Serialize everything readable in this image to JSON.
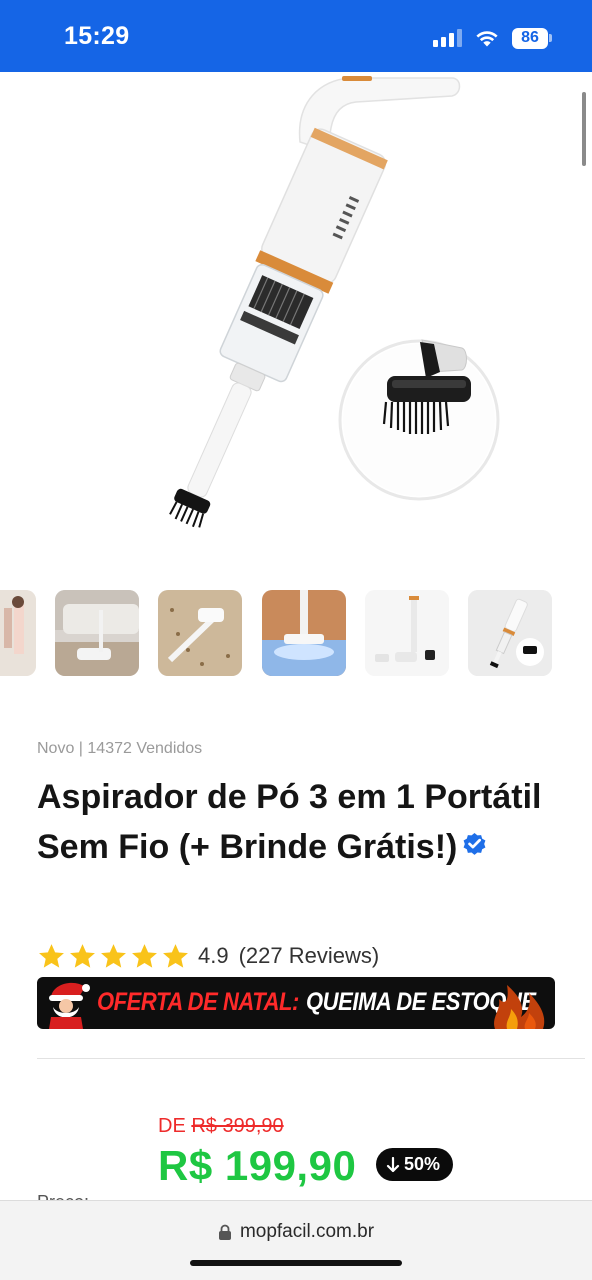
{
  "status_bar": {
    "time": "15:29",
    "battery_level": "86",
    "icons": [
      "signal-icon",
      "wifi-icon",
      "battery-icon"
    ],
    "background_color": "#1565e6"
  },
  "gallery": {
    "hero_alt": "product-hero-image",
    "thumbnail_count": 6,
    "selected_thumbnail_index": 5
  },
  "product": {
    "meta": "Novo | 14372 Vendidos",
    "title": "Aspirador de Pó 3 em 1 Portátil Sem Fio (+ Brinde Grátis!)",
    "rating_value": "4.9",
    "rating_reviews": "(227 Reviews)",
    "stars": 5
  },
  "banner": {
    "highlight": "OFERTA DE NATAL:",
    "text": "QUEIMA DE ESTOQUE"
  },
  "pricing": {
    "old_prefix": "DE",
    "old_price": "R$ 399,90",
    "new_price": "R$ 199,90",
    "discount": "50%",
    "label": "Preço:"
  },
  "browser": {
    "url": "mopfacil.com.br"
  },
  "colors": {
    "accent_blue": "#1565e6",
    "price_green": "#1ec742",
    "old_price_red": "#ee2b2b",
    "star_yellow": "#f9c31a"
  }
}
